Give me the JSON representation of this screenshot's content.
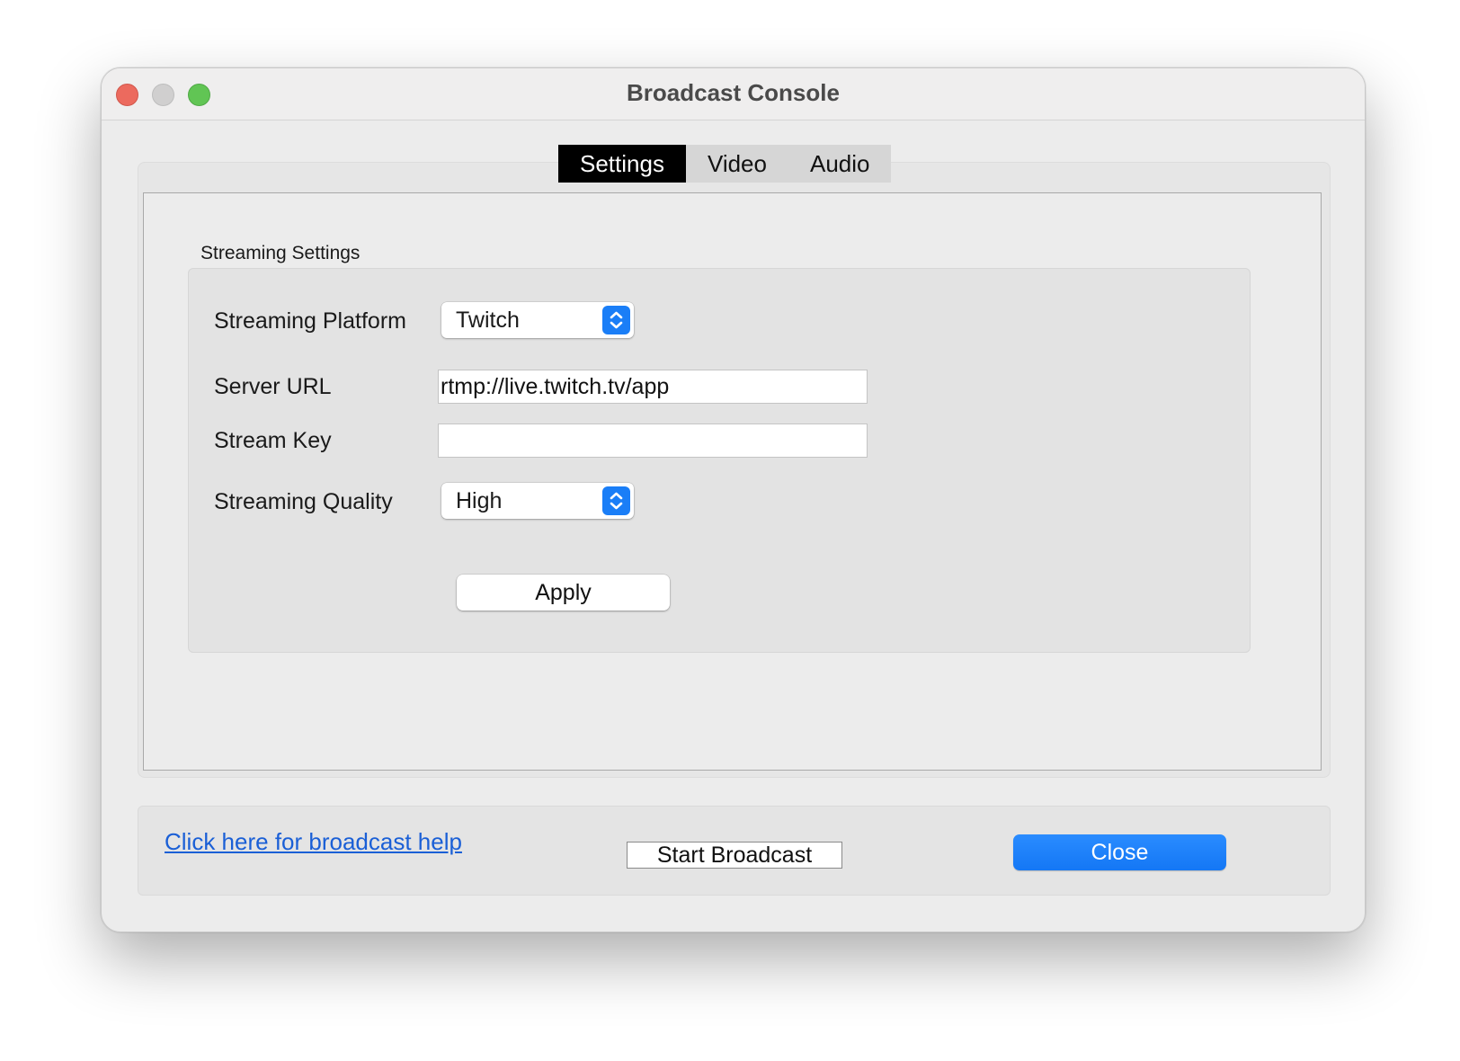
{
  "window": {
    "title": "Broadcast Console"
  },
  "tabs": [
    {
      "label": "Settings",
      "active": true
    },
    {
      "label": "Video",
      "active": false
    },
    {
      "label": "Audio",
      "active": false
    }
  ],
  "streaming_settings": {
    "group_label": "Streaming Settings",
    "platform": {
      "label": "Streaming Platform",
      "selected": "Twitch"
    },
    "server_url": {
      "label": "Server URL",
      "value": "rtmp://live.twitch.tv/app"
    },
    "stream_key": {
      "label": "Stream Key",
      "value": ""
    },
    "quality": {
      "label": "Streaming Quality",
      "selected": "High"
    },
    "apply_label": "Apply"
  },
  "footer": {
    "help_link": "Click here for broadcast help",
    "start_label": "Start Broadcast",
    "close_label": "Close"
  },
  "colors": {
    "accent": "#1a7ef7",
    "link": "#1a5fd6",
    "traffic_close": "#ec6a5e",
    "traffic_min": "#d0cfcf",
    "traffic_max": "#61c554"
  }
}
